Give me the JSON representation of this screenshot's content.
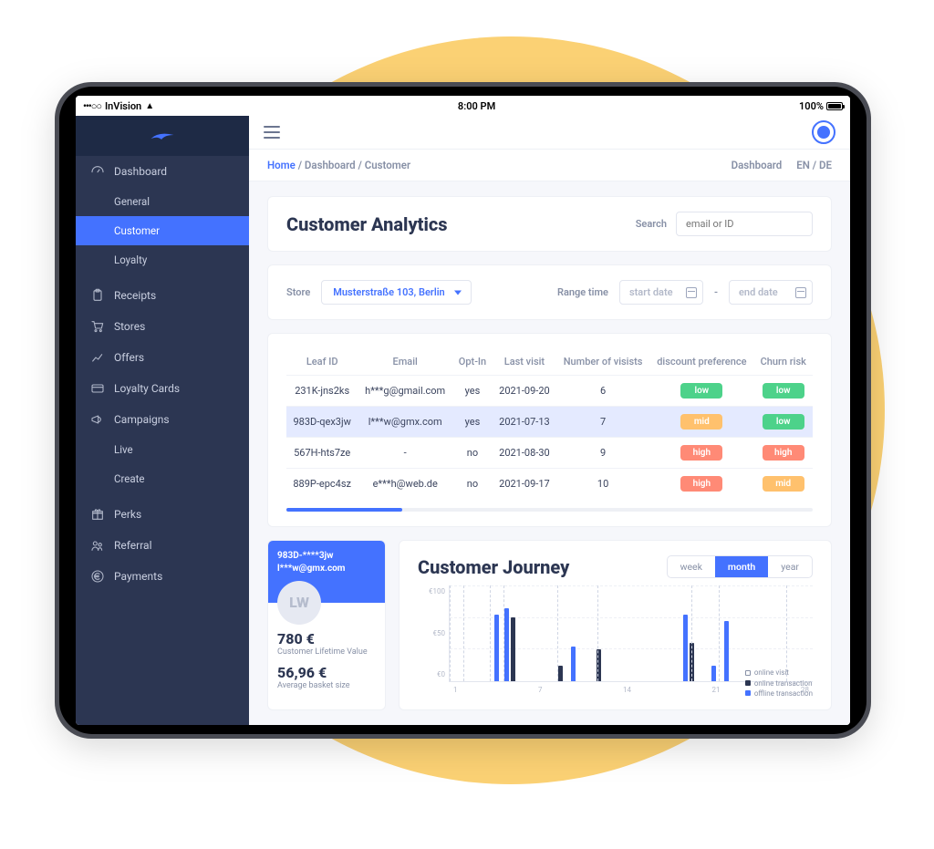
{
  "statusbar": {
    "carrier": "InVision",
    "time": "8:00 PM",
    "battery": "100%"
  },
  "sidebar": {
    "items": [
      {
        "label": "Dashboard",
        "icon": "gauge"
      },
      {
        "label": "General",
        "sub": true
      },
      {
        "label": "Customer",
        "sub": true,
        "active": true
      },
      {
        "label": "Loyalty",
        "sub": true
      },
      {
        "label": "Receipts",
        "icon": "clipboard"
      },
      {
        "label": "Stores",
        "icon": "cart"
      },
      {
        "label": "Offers",
        "icon": "chart-up"
      },
      {
        "label": "Loyalty Cards",
        "icon": "card"
      },
      {
        "label": "Campaigns",
        "icon": "megaphone"
      },
      {
        "label": "Live",
        "sub": true
      },
      {
        "label": "Create",
        "sub": true
      },
      {
        "label": "Perks",
        "icon": "gift"
      },
      {
        "label": "Referral",
        "icon": "users"
      },
      {
        "label": "Payments",
        "icon": "euro"
      }
    ]
  },
  "breadcrumb": {
    "home": "Home",
    "path1": "Dashboard",
    "path2": "Customer",
    "dashboard_link": "Dashboard",
    "lang_en": "EN",
    "lang_de": "DE"
  },
  "page": {
    "title": "Customer Analytics",
    "search_label": "Search",
    "search_placeholder": "email or ID"
  },
  "filters": {
    "store_label": "Store",
    "store_value": "Musterstraße 103, Berlin",
    "range_label": "Range time",
    "start_placeholder": "start date",
    "end_placeholder": "end date",
    "dash": "-"
  },
  "table": {
    "headers": [
      "Leaf ID",
      "Email",
      "Opt-In",
      "Last visit",
      "Number of visists",
      "discount preference",
      "Churn risk"
    ],
    "rows": [
      {
        "id": "231K-jns2ks",
        "email": "h***g@gmail.com",
        "optin": "yes",
        "last": "2021-09-20",
        "visits": "6",
        "disc": "low",
        "disc_cls": "green",
        "churn": "low",
        "churn_cls": "green"
      },
      {
        "id": "983D-qex3jw",
        "email": "l***w@gmx.com",
        "optin": "yes",
        "last": "2021-07-13",
        "visits": "7",
        "disc": "mid",
        "disc_cls": "yellow",
        "churn": "low",
        "churn_cls": "green",
        "selected": true
      },
      {
        "id": "567H-hts7ze",
        "email": "-",
        "optin": "no",
        "last": "2021-08-30",
        "visits": "9",
        "disc": "high",
        "disc_cls": "red",
        "churn": "high",
        "churn_cls": "red"
      },
      {
        "id": "889P-epc4sz",
        "email": "e***h@web.de",
        "optin": "no",
        "last": "2021-09-17",
        "visits": "10",
        "disc": "high",
        "disc_cls": "red",
        "churn": "mid",
        "churn_cls": "yellow"
      }
    ]
  },
  "customer_card": {
    "id_line": "983D-****3jw",
    "email_line": "l***w@gmx.com",
    "initials": "LW",
    "clv_value": "780 €",
    "clv_label": "Customer Lifetime Value",
    "basket_value": "56,96 €",
    "basket_label": "Average basket size"
  },
  "journey": {
    "title": "Customer Journey",
    "toggle": {
      "week": "week",
      "month": "month",
      "year": "year",
      "active": "month"
    },
    "legend": {
      "a": "online visit",
      "b": "online transaction",
      "c": "offline transaction"
    }
  },
  "chart_data": {
    "type": "bar",
    "title": "Customer Journey",
    "ylabel": "",
    "ylim": [
      0,
      150
    ],
    "y_ticks": [
      "€100",
      "€50",
      "€0"
    ],
    "x_ticks": [
      "1",
      "7",
      "14",
      "21",
      "28"
    ],
    "legend": [
      "online visit",
      "online transaction",
      "offline transaction"
    ],
    "days_shown": 28,
    "markers": [
      1,
      2,
      4,
      5,
      9,
      12,
      19,
      21,
      26
    ],
    "bars": [
      {
        "day": 4,
        "offline": 105,
        "online": 0
      },
      {
        "day": 5,
        "offline": 115,
        "online": 100
      },
      {
        "day": 9,
        "offline": 0,
        "online": 25
      },
      {
        "day": 10,
        "offline": 55,
        "online": 0
      },
      {
        "day": 12,
        "offline": 0,
        "online": 50
      },
      {
        "day": 19,
        "offline": 105,
        "online": 60
      },
      {
        "day": 21,
        "offline": 25,
        "online": 0
      },
      {
        "day": 22,
        "offline": 95,
        "online": 0
      }
    ]
  }
}
